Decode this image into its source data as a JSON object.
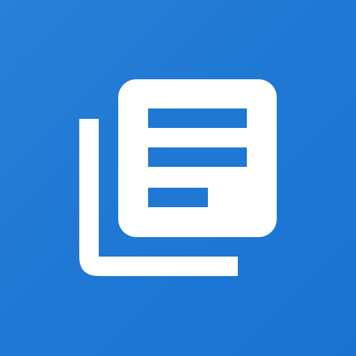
{
  "icon": {
    "name": "document-stack-icon",
    "background_color": "#1e78d4",
    "foreground_color": "#ffffff"
  }
}
